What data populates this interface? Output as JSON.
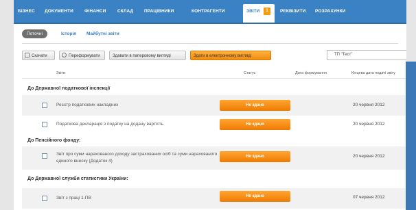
{
  "nav": {
    "items": [
      "БІЗНЕС",
      "ДОКУМЕНТИ",
      "ФІНАНСИ",
      "СКЛАД",
      "ПРАЦІВНИКИ",
      "КОНТРАГЕНТИ",
      "ЗВІТИ",
      "РЕКВІЗИТИ",
      "РОЗРАХУНКИ"
    ],
    "active": "ЗВІТИ",
    "badge": "1"
  },
  "tabs": {
    "active": "Поточні",
    "link1": "Історія",
    "link2": "Майбутні звіти"
  },
  "toolbar": {
    "btn1": "Скачати",
    "btn2": "Переформувати",
    "btn3": "Здавати в паперовому вигляді",
    "btn4": "Здати в електронному вигляді"
  },
  "select": {
    "value": "ТП \"Тест\""
  },
  "columns": {
    "name": "Звіти",
    "status": "Статус",
    "date_formed": "Дата формування",
    "deadline": "Кінцева дата подачі звіту"
  },
  "groups": {
    "g1": "До Державної податкової інспекції",
    "g2": "До Пенсійного фонду:",
    "g3": "До Державної служби статистики України:"
  },
  "rows": [
    {
      "name": "Реєстр податкових накладних",
      "status": "Не здано",
      "date": "20 червня 2012"
    },
    {
      "name": "Податкова декларація з податку на додану вартість",
      "status": "Не здано",
      "date": "20 червня 2012"
    },
    {
      "name": "Звіт про суми нарахованого доходу застрахованих осіб та суми нарахованого єдиного внеску (Додаток 4)",
      "status": "Не здано",
      "date": "20 червня 2012"
    },
    {
      "name": "Звіт з праці 1-ПВ",
      "status": "Не здано",
      "date": "07 червня 2012"
    }
  ],
  "colors": {
    "nav": "#3a82c4",
    "status": "#f08a10",
    "badge": "#f39c12"
  }
}
